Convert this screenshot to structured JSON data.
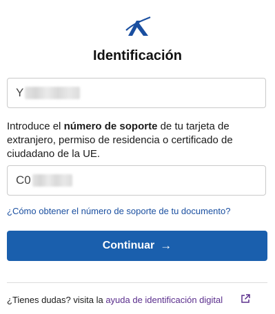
{
  "form": {
    "title": "Identificación",
    "field1_prefix": "Y",
    "instructions_pre": "Introduce el ",
    "instructions_bold": "número de soporte",
    "instructions_post": " de tu tarjeta de extranjero, permiso de residencia o certificado de ciudadano de la UE.",
    "field2_prefix": "C0",
    "help_link": "¿Cómo obtener el número de soporte de tu documento?",
    "continue_label": "Continuar",
    "continue_icon": "arrow-right-icon"
  },
  "footer": {
    "question": "¿Tienes dudas? visita la ",
    "link": "ayuda de identificación digital",
    "icon": "external-link-icon"
  },
  "colors": {
    "primary": "#1a5fad",
    "link": "#1a4fa0",
    "visited_link": "#5a2d8c",
    "logo": "#1a4fa0"
  }
}
